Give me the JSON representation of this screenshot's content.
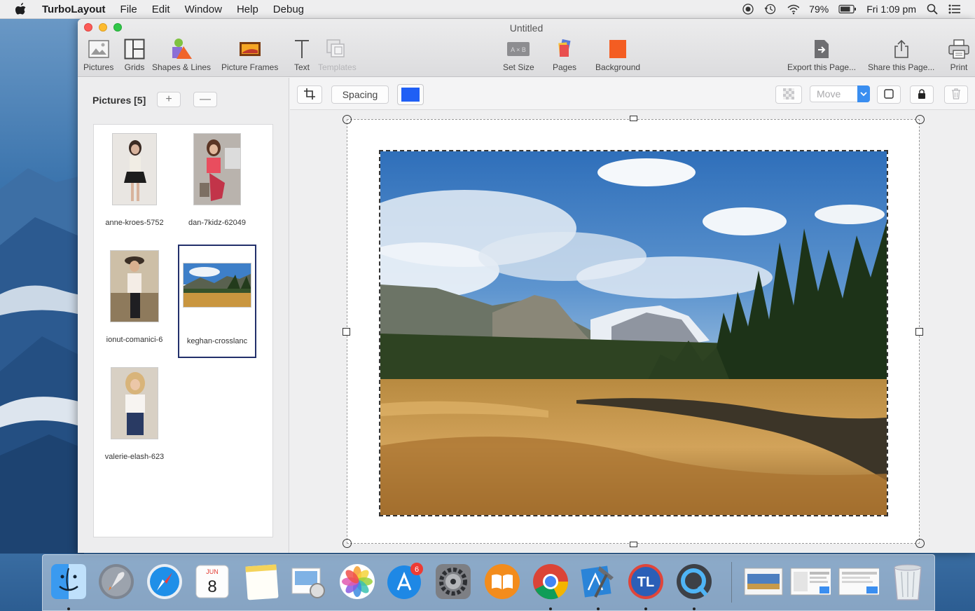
{
  "menubar": {
    "app_name": "TurboLayout",
    "items": [
      "File",
      "Edit",
      "Window",
      "Help",
      "Debug"
    ],
    "battery": "79%",
    "clock": "Fri 1:09 pm"
  },
  "window": {
    "title": "Untitled",
    "toolbar": {
      "pictures": "Pictures",
      "grids": "Grids",
      "shapes": "Shapes & Lines",
      "frames": "Picture Frames",
      "text": "Text",
      "templates": "Templates",
      "set_size": "Set Size",
      "set_size_glyph": "A × B",
      "pages": "Pages",
      "background": "Background",
      "export": "Export this Page...",
      "share": "Share this Page...",
      "print": "Print"
    }
  },
  "left_panel": {
    "heading": "Pictures [5]",
    "add_label": "+",
    "remove_label": "—",
    "pictures": [
      {
        "name": "anne-kroes-5752",
        "selected": false
      },
      {
        "name": "dan-7kidz-62049",
        "selected": false
      },
      {
        "name": "ionut-comanici-6",
        "selected": false
      },
      {
        "name": "keghan-crosslanc",
        "selected": true
      },
      {
        "name": "valerie-elash-623",
        "selected": false
      }
    ]
  },
  "sub_toolbar": {
    "spacing_label": "Spacing",
    "fill_color": "#1f5ff5",
    "move_value": "Move"
  },
  "colors": {
    "accent": "#3a8ef0",
    "selection_border": "#23306b",
    "dock_badge": "#ee3b33"
  },
  "dock": {
    "calendar_month": "JUN",
    "calendar_day": "8",
    "appstore_badge": "6",
    "turbolayout_glyph": "TL"
  }
}
